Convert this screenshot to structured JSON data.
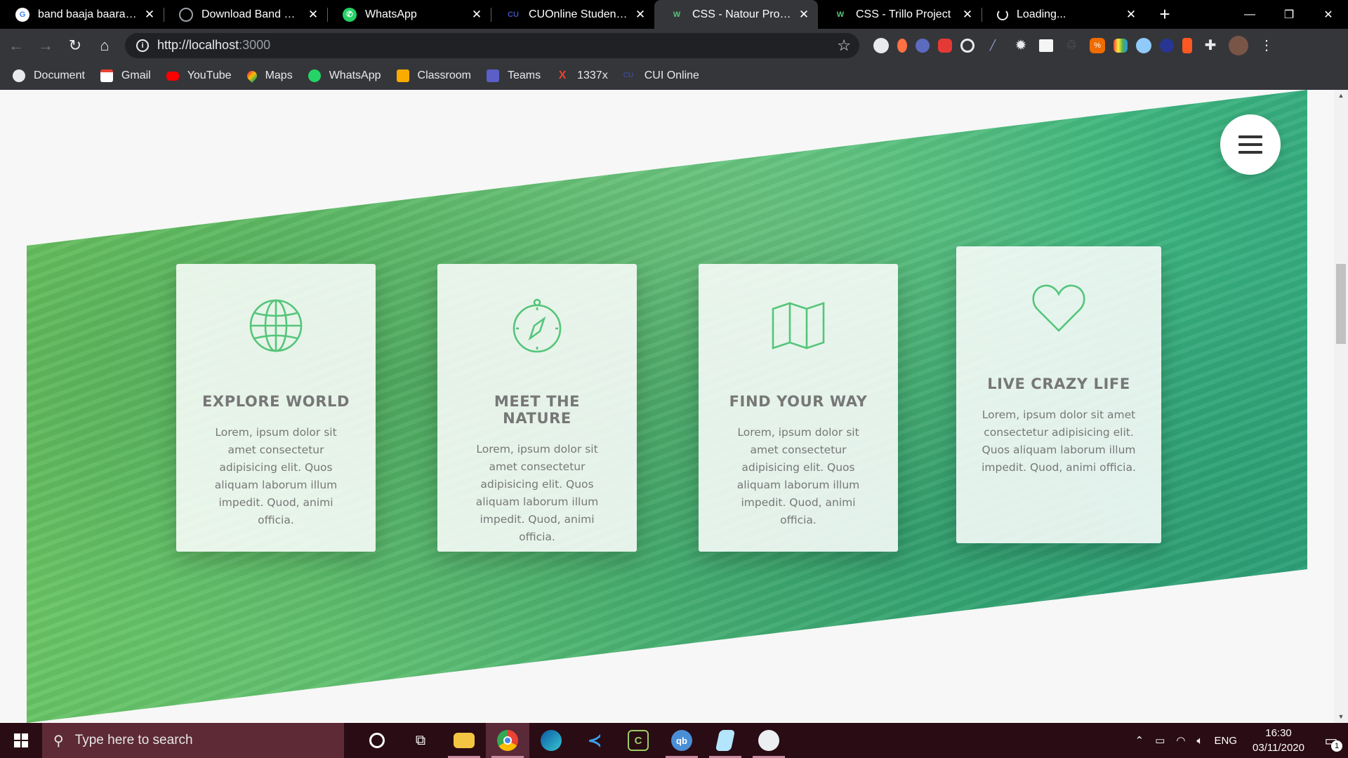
{
  "browser": {
    "tabs": [
      {
        "title": "band baaja baaraat - G",
        "favicon": "google-icon",
        "color": "#4285f4"
      },
      {
        "title": "Download Band Baaja B",
        "favicon": "globe-icon",
        "color": "#9aa0a6"
      },
      {
        "title": "WhatsApp",
        "favicon": "whatsapp-icon",
        "color": "#25d366"
      },
      {
        "title": "CUOnline Student Portal",
        "favicon": "cu-icon",
        "color": "#1a237e"
      },
      {
        "title": "CSS - Natour Project",
        "favicon": "natour-icon",
        "color": "#55c57a",
        "active": true
      },
      {
        "title": "CSS - Trillo Project",
        "favicon": "trillo-icon",
        "color": "#55c57a"
      },
      {
        "title": "Loading...",
        "favicon": "loading-icon",
        "color": "#e8eaed"
      }
    ],
    "url_host": "http://localhost",
    "url_port": ":3000",
    "bookmarks": [
      {
        "label": "Document",
        "icon": "globe-icon",
        "color": "#e8eaed"
      },
      {
        "label": "Gmail",
        "icon": "gmail-icon",
        "color": "#ea4335"
      },
      {
        "label": "YouTube",
        "icon": "youtube-icon",
        "color": "#ff0000"
      },
      {
        "label": "Maps",
        "icon": "maps-icon",
        "color": "#34a853"
      },
      {
        "label": "WhatsApp",
        "icon": "whatsapp-icon",
        "color": "#25d366"
      },
      {
        "label": "Classroom",
        "icon": "classroom-icon",
        "color": "#f9ab00"
      },
      {
        "label": "Teams",
        "icon": "teams-icon",
        "color": "#5b5fc7"
      },
      {
        "label": "1337x",
        "icon": "x-icon",
        "color": "#e8452c"
      },
      {
        "label": "CUI Online",
        "icon": "cu-icon",
        "color": "#1a237e"
      }
    ]
  },
  "page": {
    "features": [
      {
        "title": "Explore world",
        "icon": "globe-icon",
        "text": "Lorem, ipsum dolor sit amet consectetur adipisicing elit. Quos aliquam laborum illum impedit. Quod, animi officia."
      },
      {
        "title": "Meet the nature",
        "icon": "compass-icon",
        "text": "Lorem, ipsum dolor sit amet consectetur adipisicing elit. Quos aliquam laborum illum impedit. Quod, animi officia."
      },
      {
        "title": "Find your way",
        "icon": "map-icon",
        "text": "Lorem, ipsum dolor sit amet consectetur adipisicing elit. Quos aliquam laborum illum impedit. Quod, animi officia."
      },
      {
        "title": "Live crazy life",
        "icon": "heart-icon",
        "text": "Lorem, ipsum dolor sit amet consectetur adipisicing elit. Quos aliquam laborum illum impedit. Quod, animi officia."
      }
    ],
    "accent_color": "#55c57a"
  },
  "taskbar": {
    "search_placeholder": "Type here to search",
    "language": "ENG",
    "time": "16:30",
    "date": "03/11/2020",
    "notification_count": "1"
  }
}
